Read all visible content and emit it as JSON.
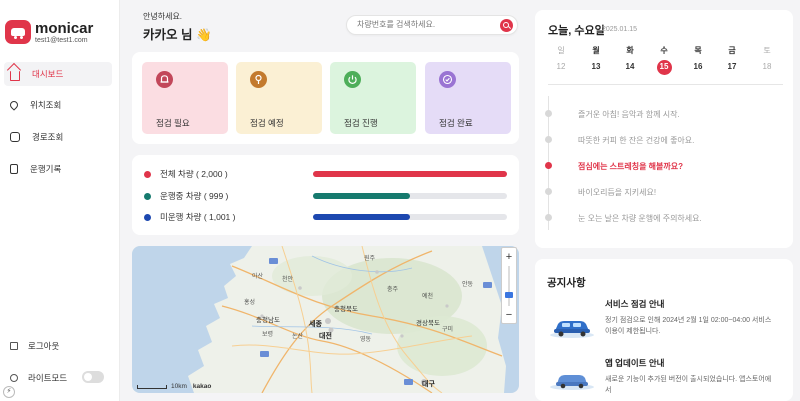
{
  "app": {
    "brand": "monicar",
    "account": "test1@test1.com"
  },
  "sidebar": {
    "items": [
      {
        "label": "대시보드",
        "icon": "home-icon",
        "active": true
      },
      {
        "label": "위치조회",
        "icon": "location-pin-icon"
      },
      {
        "label": "경로조회",
        "icon": "route-icon"
      },
      {
        "label": "운행기록",
        "icon": "document-icon"
      }
    ],
    "logout_label": "로그아웃",
    "lightmode_label": "라이트모드"
  },
  "header": {
    "greeting": "안녕하세요.",
    "user": "카카오 님 👋"
  },
  "search": {
    "placeholder": "차량번호를 검색하세요."
  },
  "status_cards": [
    {
      "label": "점검 필요",
      "icon": "bell-icon",
      "bg": "#fbdde2",
      "accent": "#c2475a"
    },
    {
      "label": "점검 예정",
      "icon": "exclamation-icon",
      "bg": "#fbf0d4",
      "accent": "#c37a2d"
    },
    {
      "label": "점검 진행",
      "icon": "power-icon",
      "bg": "#dcf4de",
      "accent": "#4eae5a"
    },
    {
      "label": "점검 완료",
      "icon": "check-circle-icon",
      "bg": "#e5dcf7",
      "accent": "#9a74d3"
    }
  ],
  "vehicle_counts": [
    {
      "label": "전체 차량 ( 2,000 )",
      "color": "#e0354a",
      "ratio": 1.0
    },
    {
      "label": "운행중 차량 ( 999 )",
      "color": "#167a6e",
      "ratio": 0.5
    },
    {
      "label": "미운행 차량 ( 1,001 )",
      "color": "#1d48b0",
      "ratio": 0.5
    }
  ],
  "map": {
    "labels": [
      "충청북도",
      "충청남도",
      "경상북도",
      "세종",
      "대전",
      "대구"
    ],
    "scale": "10km",
    "provider": "kakao",
    "zoom_in": "+",
    "zoom_out": "−"
  },
  "calendar": {
    "title": "오늘, 수요일",
    "date": "2025.01.15",
    "weekdays": [
      "일",
      "월",
      "화",
      "수",
      "목",
      "금",
      "토"
    ],
    "days": [
      "12",
      "13",
      "14",
      "15",
      "16",
      "17",
      "18"
    ],
    "today_index": 3
  },
  "timeline": [
    {
      "text": "즐거운 아침! 음악과 함께 시작.",
      "active": false
    },
    {
      "text": "따뜻한 커피 한 잔은 건강에 좋아요.",
      "active": false
    },
    {
      "text": "점심에는 스트레칭을 해볼까요?",
      "active": true
    },
    {
      "text": "바이오리듬을 지키세요!",
      "active": false
    },
    {
      "text": "눈 오는 날은 차량 운행에 주의하세요.",
      "active": false
    }
  ],
  "notices": {
    "title": "공지사항",
    "items": [
      {
        "title": "서비스 점검 안내",
        "body": "정기 점검으로 인해 2024년 2월 1일 02:00~04:00 서비스 이용이 제한됩니다."
      },
      {
        "title": "앱 업데이트 안내",
        "body": "새로운 기능이 추가된 버전이 출시되었습니다. 앱스토어에서"
      }
    ]
  },
  "colors": {
    "accent": "#e0354a"
  }
}
